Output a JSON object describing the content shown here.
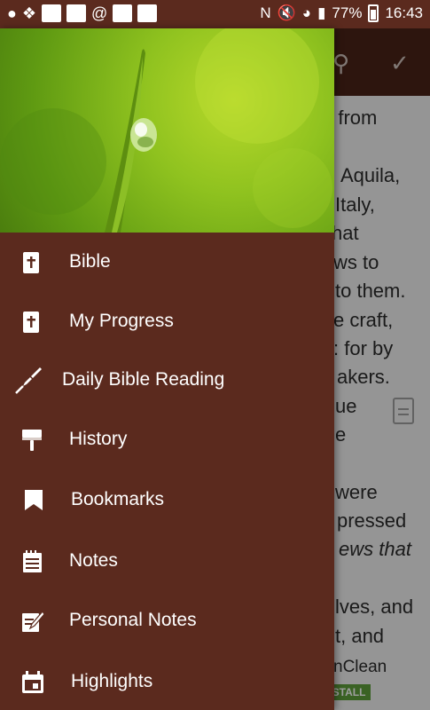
{
  "status_bar": {
    "battery": "77%",
    "time": "16:43",
    "at_symbol": "@",
    "nfc": "N"
  },
  "background_app": {
    "lines": [
      "d from",
      "Aquila,",
      "Italy,",
      "hat",
      "ws to",
      "to them.",
      "e craft,",
      ": for by",
      "akers.",
      "ue",
      "e",
      "were",
      "pressed",
      "ews that",
      "lves, and",
      "t, and",
      "nClean"
    ],
    "ad_button": "NSTALL"
  },
  "drawer": {
    "menu": [
      {
        "label": "Bible",
        "icon": "bible-icon"
      },
      {
        "label": "My Progress",
        "icon": "bible-icon"
      },
      {
        "label": "Daily Bible Reading",
        "icon": "quill-icon"
      },
      {
        "label": "History",
        "icon": "paintbrush-icon"
      },
      {
        "label": "Bookmarks",
        "icon": "bookmark-icon"
      },
      {
        "label": "Notes",
        "icon": "notepad-icon"
      },
      {
        "label": "Personal Notes",
        "icon": "edit-note-icon"
      },
      {
        "label": "Highlights",
        "icon": "calendar-icon"
      }
    ]
  }
}
